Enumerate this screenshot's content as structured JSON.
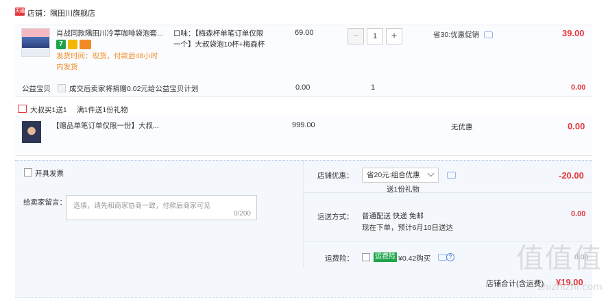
{
  "shop": {
    "badge": "天猫",
    "name": "店铺：隅田川旗舰店"
  },
  "item": {
    "title": "肖战同款隅田川冷萃咖啡袋泡套...",
    "shipping_note": "发货时间：现货，付款后48小时内发货",
    "flavor": "口味：【梅森杯单笔订单仅限一个】大叔袋泡10杯+梅森杯",
    "unit_price": "69.00",
    "quantity": "1",
    "promo": "省30:优惠促销",
    "subtotal": "39.00"
  },
  "charity": {
    "label": "公益宝贝",
    "text": "成交后卖家将捐赠0.02元给公益宝贝计划",
    "price": "0.00",
    "quantity": "1",
    "subtotal": "0.00"
  },
  "gift_promo": {
    "label": "大叔买1送1",
    "text": "满1件送1份礼物"
  },
  "gift_item": {
    "title": "【赠品单笔订单仅限一份】大叔...",
    "price": "999.00",
    "promo": "无优惠",
    "subtotal": "0.00"
  },
  "invoice": {
    "label": "开具发票"
  },
  "message": {
    "label": "给卖家留言：",
    "placeholder": "选填，请先和商家协商一致，付款后商家可见",
    "counter": "0/200"
  },
  "discount": {
    "label": "店铺优惠：",
    "selected": "省20元:组合优惠",
    "gift_note": "送1份礼物",
    "amount": "-20.00"
  },
  "delivery": {
    "label": "运送方式：",
    "method": "普通配送 快递 免邮",
    "eta": "现在下单，预计6月10日送达",
    "fee": "0.00"
  },
  "insurance": {
    "label": "运费险：",
    "badge": "运费险",
    "text": "¥0.42购买",
    "help": "?",
    "amount": "0.00"
  },
  "total": {
    "label": "店铺合计(含运费)",
    "amount": "¥19.00"
  },
  "watermark": {
    "main": "值值值",
    "sub": "zhizhizhi.com"
  },
  "colors": {
    "price_red": "#e4393c",
    "shipping_orange": "#f08a24",
    "badge_green": "#1ea44a"
  }
}
